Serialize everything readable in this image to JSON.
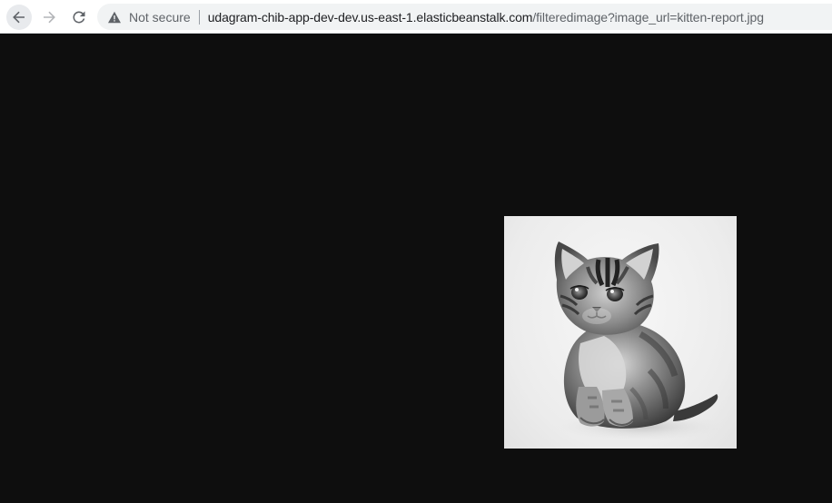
{
  "browser": {
    "security_label": "Not secure",
    "url_host": "udagram-chib-app-dev-dev.us-east-1.elasticbeanstalk.com",
    "url_path": "/filteredimage?image_url=kitten-report.jpg",
    "icons": {
      "back": "arrow-left-icon",
      "forward": "arrow-right-icon",
      "reload": "reload-icon",
      "security": "warning-triangle-icon"
    }
  },
  "page": {
    "background": "#0e0e0e",
    "image": "grayscale-kitten-photo"
  }
}
